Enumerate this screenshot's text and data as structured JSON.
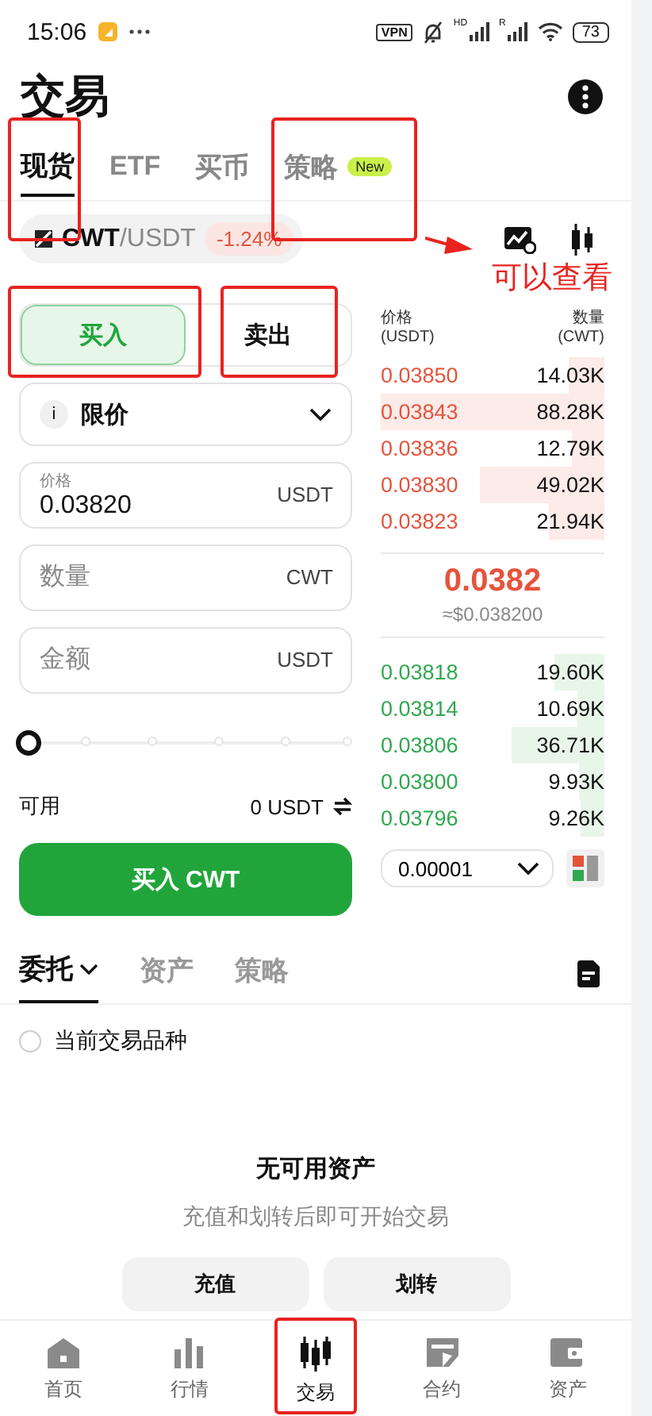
{
  "status_bar": {
    "time": "15:06",
    "vpn": "VPN",
    "signal_labels": [
      "HD",
      "R"
    ],
    "battery": "73"
  },
  "title": "交易",
  "tabs": [
    {
      "label": "现货",
      "selected": true,
      "highlighted": true
    },
    {
      "label": "ETF",
      "selected": false,
      "highlighted": false
    },
    {
      "label": "买币",
      "selected": false,
      "highlighted": false
    },
    {
      "label": "策略",
      "selected": false,
      "highlighted": true,
      "badge": "New"
    }
  ],
  "annotation": {
    "note": "可以查看"
  },
  "pair": {
    "base": "CWT",
    "quote": "/USDT",
    "change": "-1.24%"
  },
  "sides": [
    {
      "label": "买入",
      "selected": true,
      "highlighted": true
    },
    {
      "label": "卖出",
      "selected": false,
      "highlighted": true
    }
  ],
  "order_type": {
    "info": "i",
    "value": "限价"
  },
  "fields": [
    {
      "label": "价格",
      "value": "0.03820",
      "unit": "USDT"
    },
    {
      "placeholder": "数量",
      "unit": "CWT"
    },
    {
      "placeholder": "金额",
      "unit": "USDT"
    }
  ],
  "amount_slider": {
    "level": 0
  },
  "available": {
    "label": "可用",
    "value": "0 USDT"
  },
  "submit": "买入 CWT",
  "order_book": {
    "price_header": "价格",
    "price_unit": "(USDT)",
    "qty_header": "数量",
    "qty_unit": "(CWT)",
    "asks": [
      {
        "price": "0.03850",
        "amount": "14.03K"
      },
      {
        "price": "0.03843",
        "amount": "88.28K"
      },
      {
        "price": "0.03836",
        "amount": "12.79K"
      },
      {
        "price": "0.03830",
        "amount": "49.02K"
      },
      {
        "price": "0.03823",
        "amount": "21.94K"
      }
    ],
    "last_price": "0.0382",
    "last_price_usd": "≈$0.038200",
    "bids": [
      {
        "price": "0.03818",
        "amount": "19.60K"
      },
      {
        "price": "0.03814",
        "amount": "10.69K"
      },
      {
        "price": "0.03806",
        "amount": "36.71K"
      },
      {
        "price": "0.03800",
        "amount": "9.93K"
      },
      {
        "price": "0.03796",
        "amount": "9.26K"
      }
    ],
    "precision": "0.00001"
  },
  "bottom_tabs": [
    {
      "label": "委托",
      "selected": true,
      "dropdown": true
    },
    {
      "label": "资产",
      "selected": false,
      "dropdown": false
    },
    {
      "label": "策略",
      "selected": false,
      "dropdown": false
    }
  ],
  "filter": {
    "label": "当前交易品种",
    "checked": false
  },
  "empty": {
    "title": "无可用资产",
    "message": "充值和划转后即可开始交易",
    "actions": [
      "充值",
      "划转"
    ]
  },
  "nav": [
    {
      "label": "首页",
      "selected": false,
      "highlighted": false
    },
    {
      "label": "行情",
      "selected": false,
      "highlighted": false
    },
    {
      "label": "交易",
      "selected": true,
      "highlighted": true
    },
    {
      "label": "合约",
      "selected": false,
      "highlighted": false
    },
    {
      "label": "资产",
      "selected": false,
      "highlighted": false
    }
  ]
}
